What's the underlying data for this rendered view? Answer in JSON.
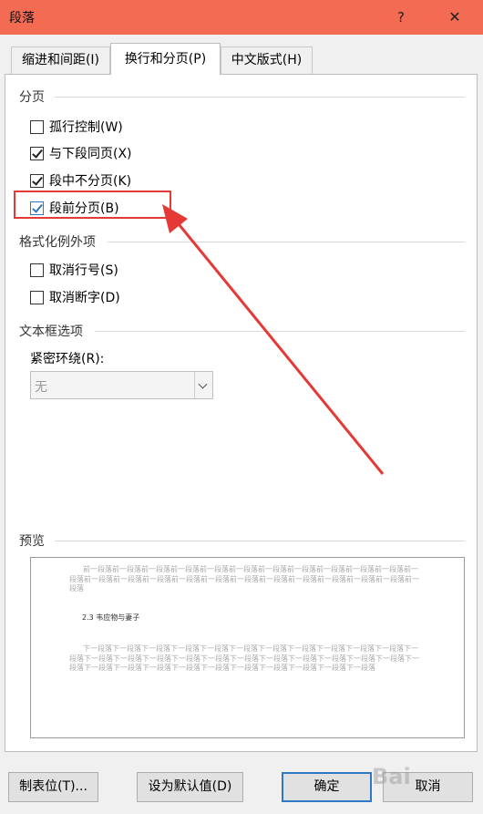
{
  "window": {
    "title": "段落",
    "help_label": "?",
    "close_label": "✕"
  },
  "tabs": [
    {
      "label": "缩进和间距(I)",
      "active": false
    },
    {
      "label": "换行和分页(P)",
      "active": true
    },
    {
      "label": "中文版式(H)",
      "active": false
    }
  ],
  "sections": {
    "pagination": "分页",
    "format_exceptions": "格式化例外项",
    "textbox_options": "文本框选项",
    "preview": "预览"
  },
  "pagination_options": [
    {
      "label": "孤行控制(W)",
      "checked": false
    },
    {
      "label": "与下段同页(X)",
      "checked": true
    },
    {
      "label": "段中不分页(K)",
      "checked": true
    },
    {
      "label": "段前分页(B)",
      "checked": true
    }
  ],
  "format_options": [
    {
      "label": "取消行号(S)",
      "checked": false
    },
    {
      "label": "取消断字(D)",
      "checked": false
    }
  ],
  "tight_wrap": {
    "label": "紧密环绕(R):",
    "value": "无"
  },
  "preview": {
    "previous_text": "前一段落前一段落前一段落前一段落前一段落前一段落前一段落前一段落前一段落前一段落前一段落前一段落前一段落前一段落前一段落前一段落前一段落前一段落前一段落前一段落前一段落前一段落前一段落前一段落",
    "current_text": "2.3 韦应物与妻子",
    "next_text": "下一段落下一段落下一段落下一段落下一段落下一段落下一段落下一段落下一段落下一段落下一段落下一段落下一段落下一段落下一段落下一段落下一段落下一段落下一段落下一段落下一段落下一段落下一段落下一段落下一段落下一段落下一段落下一段落下一段落下一段落下一段落下一段落下一段落下一段落"
  },
  "buttons": {
    "tabs": "制表位(T)...",
    "set_default": "设为默认值(D)",
    "ok": "确定",
    "cancel": "取消"
  },
  "watermark": "Bai"
}
